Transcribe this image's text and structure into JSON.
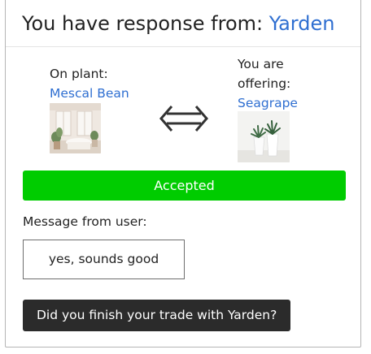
{
  "header": {
    "title_prefix": "You have response from: ",
    "user_name": "Yarden"
  },
  "left_plant": {
    "label": "On plant:",
    "name": "Mescal Bean",
    "image_icon": "room-with-plants-photo"
  },
  "right_plant": {
    "label_line1": "You are",
    "label_line2": "offering:",
    "name": "Seagrape",
    "image_icon": "potted-plants-photo"
  },
  "swap_icon": "double-arrow-icon",
  "status": {
    "label": "Accepted",
    "color": "#00cc00"
  },
  "message": {
    "label": "Message from user:",
    "text": "yes, sounds good"
  },
  "actions": {
    "finish_label": "Did you finish your trade with Yarden?"
  },
  "colors": {
    "link": "#2f6fd1",
    "button_dark": "#2b2b2b"
  }
}
